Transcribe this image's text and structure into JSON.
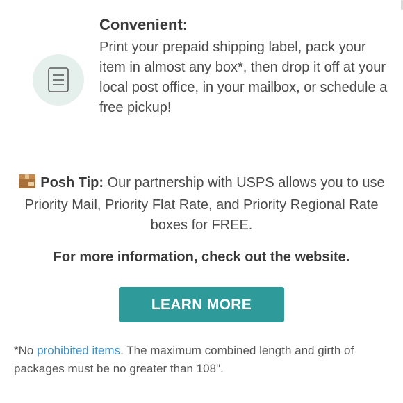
{
  "feature": {
    "title": "Convenient:",
    "description": "Print your prepaid shipping label, pack your item in almost any box*, then drop it off at your local post office, in your mailbox, or schedule a free pickup!",
    "icon": "document-icon"
  },
  "tip": {
    "icon": "package-icon",
    "label": "Posh Tip:",
    "text": " Our partnership with USPS allows you to use Priority Mail, Priority Flat Rate, and Priority Regional Rate boxes for FREE."
  },
  "more_info": "For more information, check out the website.",
  "cta": {
    "label": "LEARN MORE"
  },
  "footnote": {
    "prefix": "*No ",
    "link": "prohibited items",
    "suffix": ". The maximum combined length and girth of packages must be no greater than 108\"."
  },
  "colors": {
    "accent": "#2e9a9a",
    "link": "#3f8fc4",
    "icon_bg": "#e5efec"
  }
}
